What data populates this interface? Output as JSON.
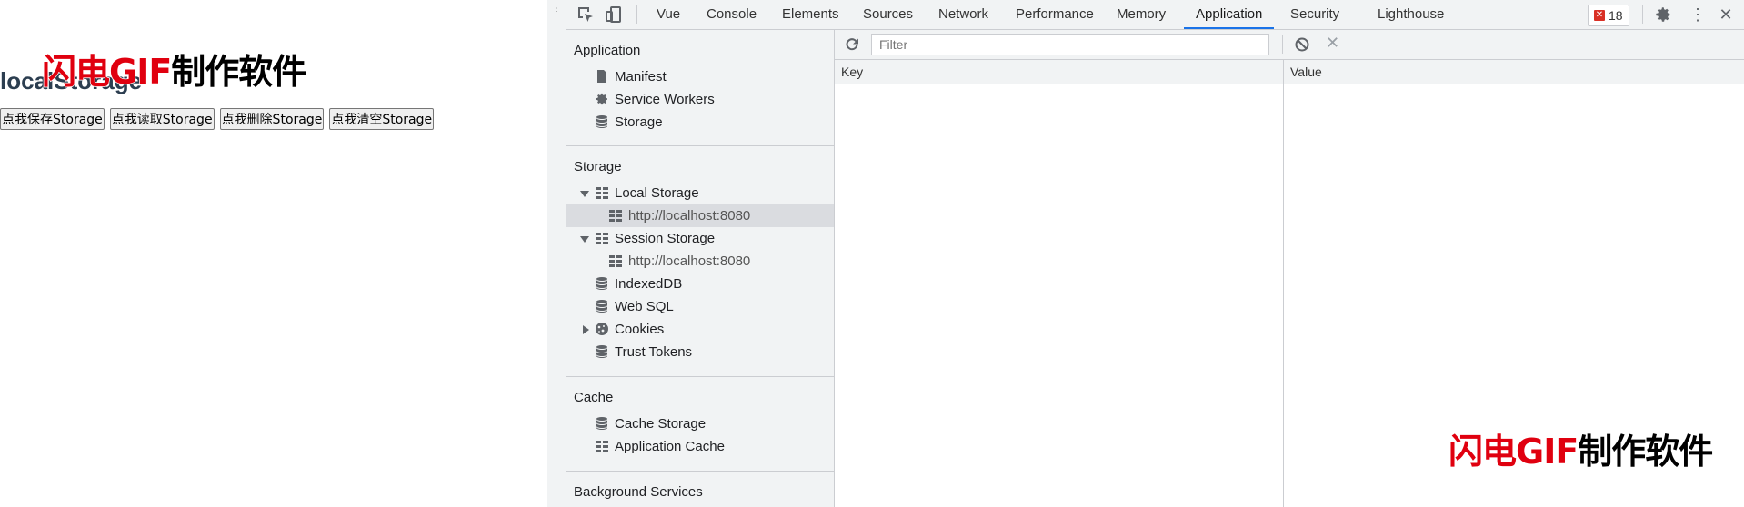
{
  "page": {
    "title": "localStorage",
    "buttons": [
      "点我保存Storage",
      "点我读取Storage",
      "点我删除Storage",
      "点我清空Storage"
    ]
  },
  "watermark": {
    "red": "闪电GIF",
    "black": "制作软件"
  },
  "devtools": {
    "tabs": [
      "Vue",
      "Console",
      "Elements",
      "Sources",
      "Network",
      "Performance",
      "Memory",
      "Application",
      "Security",
      "Lighthouse"
    ],
    "active_tab": "Application",
    "error_count": "18",
    "sidebar": {
      "sections": [
        {
          "title": "Application",
          "items": [
            {
              "label": "Manifest",
              "icon": "file-icon"
            },
            {
              "label": "Service Workers",
              "icon": "gear-icon"
            },
            {
              "label": "Storage",
              "icon": "database-icon"
            }
          ]
        },
        {
          "title": "Storage",
          "items": [
            {
              "label": "Local Storage",
              "icon": "table-icon",
              "expanded": true
            },
            {
              "label": "http://localhost:8080",
              "icon": "table-icon",
              "sub": true,
              "selected": true
            },
            {
              "label": "Session Storage",
              "icon": "table-icon",
              "expanded": true
            },
            {
              "label": "http://localhost:8080",
              "icon": "table-icon",
              "sub": true
            },
            {
              "label": "IndexedDB",
              "icon": "database-icon"
            },
            {
              "label": "Web SQL",
              "icon": "database-icon"
            },
            {
              "label": "Cookies",
              "icon": "cookie-icon",
              "collapsed": true
            },
            {
              "label": "Trust Tokens",
              "icon": "database-icon"
            }
          ]
        },
        {
          "title": "Cache",
          "items": [
            {
              "label": "Cache Storage",
              "icon": "database-icon"
            },
            {
              "label": "Application Cache",
              "icon": "table-icon"
            }
          ]
        },
        {
          "title": "Background Services",
          "items": []
        }
      ]
    },
    "filter": {
      "placeholder": "Filter",
      "value": ""
    },
    "columns": [
      "Key",
      "Value"
    ],
    "colors": {
      "accent": "#1a73e8",
      "error": "#d93025",
      "watermark_red": "#e0000f"
    }
  }
}
